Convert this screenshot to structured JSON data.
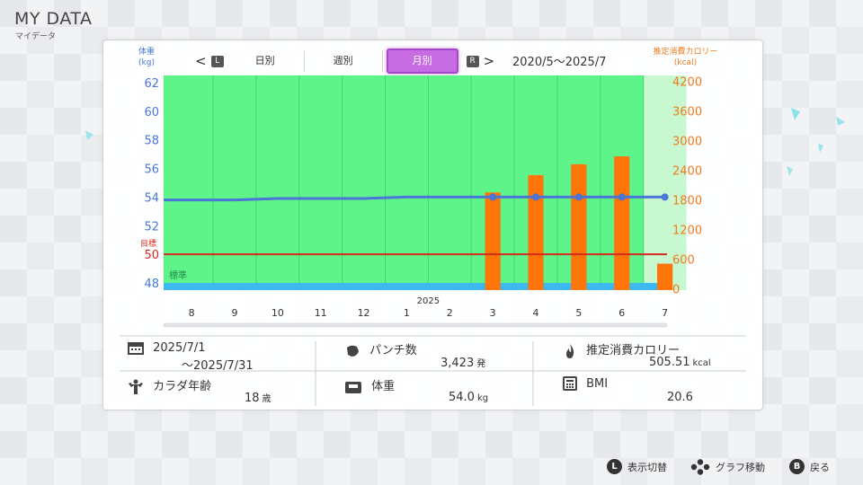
{
  "header": {
    "title": "MY DATA",
    "subtitle": "マイデータ"
  },
  "units": {
    "left_line1": "体重",
    "left_line2": "(kg)",
    "right_line1": "推定消費カロリー",
    "right_line2": "(kcal)"
  },
  "tabs": {
    "prev_badge": "L",
    "next_badge": "R",
    "daily": "日別",
    "weekly": "週別",
    "monthly": "月別",
    "active": "monthly"
  },
  "range": "2020/5〜2025/7",
  "chart_data": {
    "type": "bar+line",
    "categories": [
      "8",
      "9",
      "10",
      "11",
      "12",
      "1",
      "2",
      "3",
      "4",
      "5",
      "6",
      "7"
    ],
    "year_label": "2025",
    "left_axis": {
      "ticks": [
        48,
        50,
        52,
        54,
        56,
        58,
        60,
        62
      ],
      "range": [
        47.5,
        62.5
      ]
    },
    "right_axis": {
      "ticks": [
        0,
        600,
        1200,
        1800,
        2400,
        3000,
        3600,
        4200
      ],
      "range": [
        -30,
        4320
      ]
    },
    "calories": [
      null,
      null,
      null,
      null,
      null,
      null,
      null,
      1950,
      2300,
      2520,
      2680,
      505.51
    ],
    "weight": [
      53.8,
      53.8,
      53.9,
      53.9,
      53.9,
      54.0,
      54.0,
      54.0,
      54.0,
      54.0,
      54.0,
      54.0
    ],
    "weight_points_from_index": 7,
    "goal_weight": 50,
    "goal_label": "目標",
    "standard_band": [
      47.5,
      48.0
    ],
    "standard_label": "標準",
    "selected_index": 11,
    "colors": {
      "bg": "#5ff48a",
      "selected_bg": "#c7f8cf",
      "bar": "#ff7509",
      "line": "#4a76d6",
      "goal": "#d42b1f",
      "band": "#3db8f0"
    }
  },
  "stats": {
    "date_from": "2025/7/1",
    "date_to": "〜2025/7/31",
    "punch_label": "パンチ数",
    "punch_value": "3,423",
    "punch_unit": "発",
    "cal_label": "推定消費カロリー",
    "cal_value": "505.51",
    "cal_unit": "kcal",
    "age_label": "カラダ年齢",
    "age_value": "18",
    "age_unit": "歳",
    "weight_label": "体重",
    "weight_value": "54.0",
    "weight_unit": "kg",
    "bmi_label": "BMI",
    "bmi_value": "20.6"
  },
  "footer": {
    "toggle_badge": "L",
    "toggle_label": "表示切替",
    "move_label": "グラフ移動",
    "back_badge": "B",
    "back_label": "戻る"
  }
}
